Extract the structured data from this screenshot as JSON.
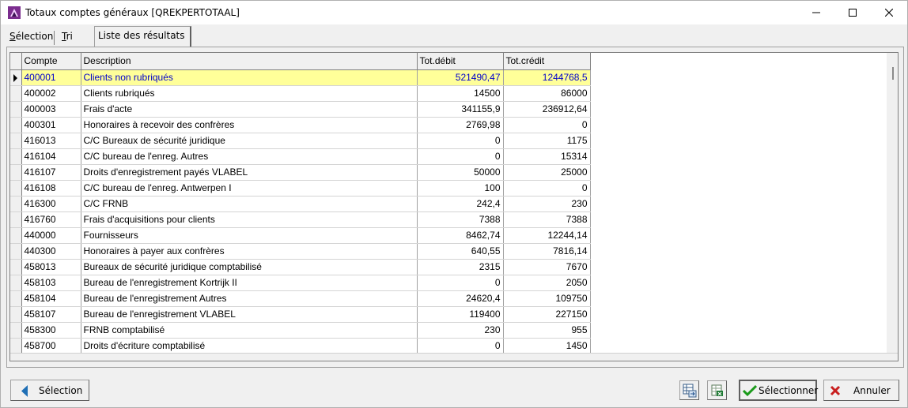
{
  "window": {
    "title": "Totaux comptes généraux [QREKPERTOTAAL]",
    "minimize": "—",
    "maximize": "☐",
    "close": "✕"
  },
  "tabs": [
    {
      "label": "Sélection"
    },
    {
      "label": "Tri"
    },
    {
      "label": "Liste des résultats"
    }
  ],
  "grid": {
    "columns": [
      "Compte",
      "Description",
      "Tot.débit",
      "Tot.crédit"
    ],
    "selected_row": 0,
    "rows": [
      [
        "400001",
        "Clients non rubriqués",
        "521490,47",
        "1244768,5"
      ],
      [
        "400002",
        "Clients rubriqués",
        "14500",
        "86000"
      ],
      [
        "400003",
        "Frais d'acte",
        "341155,9",
        "236912,64"
      ],
      [
        "400301",
        "Honoraires à recevoir des confrères",
        "2769,98",
        "0"
      ],
      [
        "416013",
        "C/C Bureaux de sécurité juridique",
        "0",
        "1175"
      ],
      [
        "416104",
        "C/C bureau de l'enreg. Autres",
        "0",
        "15314"
      ],
      [
        "416107",
        "Droits d'enregistrement payés VLABEL",
        "50000",
        "25000"
      ],
      [
        "416108",
        "C/C bureau de l'enreg. Antwerpen I",
        "100",
        "0"
      ],
      [
        "416300",
        "C/C FRNB",
        "242,4",
        "230"
      ],
      [
        "416760",
        "Frais d'acquisitions pour clients",
        "7388",
        "7388"
      ],
      [
        "440000",
        "Fournisseurs",
        "8462,74",
        "12244,14"
      ],
      [
        "440300",
        "Honoraires à payer aux confrères",
        "640,55",
        "7816,14"
      ],
      [
        "458013",
        "Bureaux de sécurité juridique comptabilisé",
        "2315",
        "7670"
      ],
      [
        "458103",
        "Bureau de l'enregistrement Kortrijk II",
        "0",
        "2050"
      ],
      [
        "458104",
        "Bureau de l'enregistrement Autres",
        "24620,4",
        "109750"
      ],
      [
        "458107",
        "Bureau de l'enregistrement VLABEL",
        "119400",
        "227150"
      ],
      [
        "458300",
        "FRNB comptabilisé",
        "230",
        "955"
      ],
      [
        "458700",
        "Droits d'écriture comptabilisé",
        "0",
        "1450"
      ]
    ]
  },
  "buttons": {
    "selection": "Sélection",
    "select": "Sélectionner",
    "cancel": "Annuler"
  },
  "colors": {
    "selected_row_bg": "#ffff99",
    "selected_row_text": "#0000cc",
    "accept_green": "#1a9a1a",
    "cancel_red": "#c81e1e",
    "back_arrow_blue": "#1f6fb5"
  }
}
